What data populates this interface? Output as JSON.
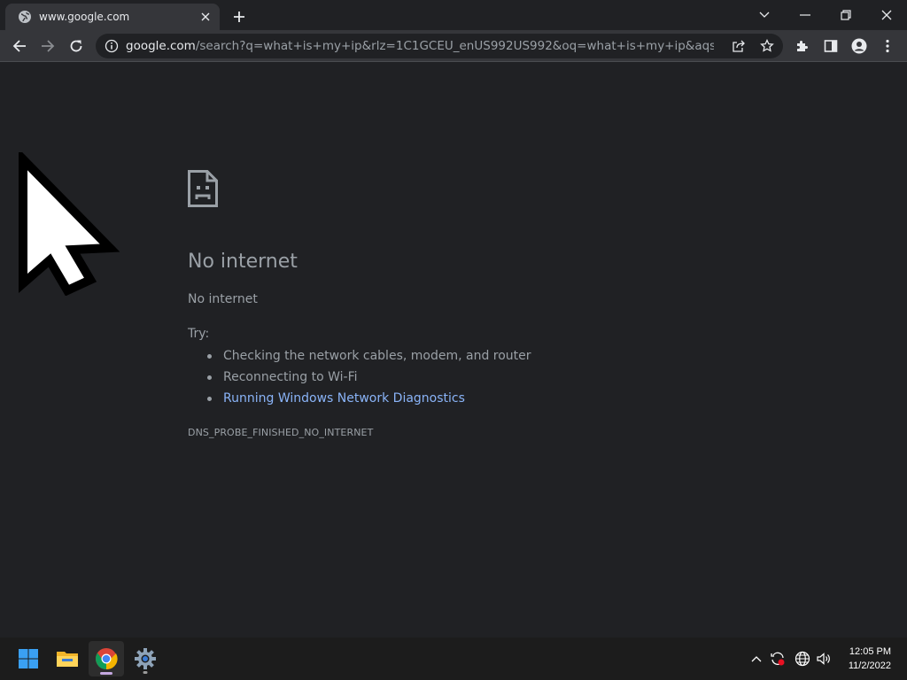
{
  "browser": {
    "tab": {
      "title": "www.google.com",
      "favicon": "globe-icon"
    },
    "address": {
      "host": "google.com",
      "path": "/search?q=what+is+my+ip&rlz=1C1GCEU_enUS992US992&oq=what+is+my+ip&aqs=chrome..."
    }
  },
  "error_page": {
    "title": "No internet",
    "subtitle": "No internet",
    "try_label": "Try:",
    "suggestions": [
      "Checking the network cables, modem, and router",
      "Reconnecting to Wi-Fi",
      "Running Windows Network Diagnostics"
    ],
    "error_code": "DNS_PROBE_FINISHED_NO_INTERNET"
  },
  "taskbar": {
    "apps": [
      "windows-start",
      "file-explorer",
      "google-chrome",
      "settings"
    ],
    "clock": {
      "time": "12:05 PM",
      "date": "11/2/2022"
    }
  },
  "colors": {
    "page_bg": "#202124",
    "toolbar_bg": "#35363a",
    "text": "#9aa0a6",
    "link": "#8ab4f8",
    "taskbar_bg": "#1c1c1c"
  }
}
